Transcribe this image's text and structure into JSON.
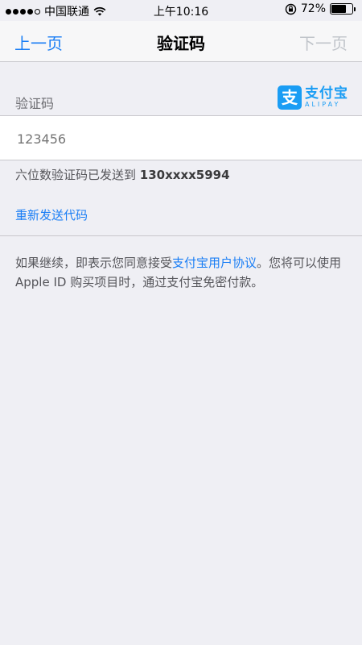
{
  "status_bar": {
    "carrier": "中国联通",
    "time": "上午10:16",
    "battery_percent": "72%",
    "battery_level": 0.72,
    "signal_bars_filled": 4,
    "signal_bars_total": 5
  },
  "nav": {
    "back_label": "上一页",
    "title": "验证码",
    "next_label": "下一页"
  },
  "section": {
    "label": "验证码"
  },
  "logo": {
    "badge_glyph": "支",
    "name_cn": "支付宝",
    "name_en": "ALIPAY"
  },
  "code_input": {
    "placeholder": "123456"
  },
  "sent_info": {
    "text": "六位数验证码已发送到",
    "phone": "130xxxx5994"
  },
  "resend": {
    "label": "重新发送代码"
  },
  "agreement": {
    "prefix": "如果继续，即表示您同意接受",
    "link": "支付宝用户协议",
    "suffix": "。您将可以使用 Apple ID 购买项目时，通过支付宝免密付款。"
  },
  "colors": {
    "accent": "#1a7ef5",
    "alipay_blue": "#1a9df4",
    "background": "#efeff4",
    "disabled": "#c0c4ca"
  }
}
